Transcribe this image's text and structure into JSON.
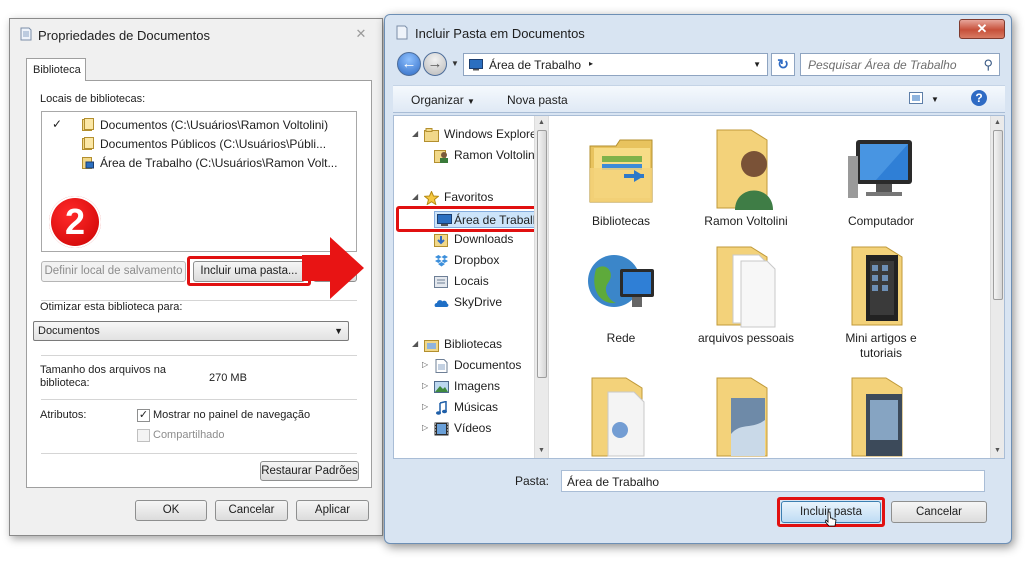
{
  "left_dialog": {
    "title": "Propriedades de Documentos",
    "close_glyph": "✕",
    "tab_label": "Biblioteca",
    "locations_label": "Locais de bibliotecas:",
    "locations": [
      {
        "check": "✓",
        "text": "Documentos (C:\\Usuários\\Ramon Voltolini)",
        "icon": "folder-icon"
      },
      {
        "check": "",
        "text": "Documentos Públicos (C:\\Usuários\\Públi...",
        "icon": "folder-icon"
      },
      {
        "check": "",
        "text": "Área de Trabalho (C:\\Usuários\\Ramon Volt...",
        "icon": "desktop-folder-icon"
      }
    ],
    "step_badge": "2",
    "set_save_label": "Definir local de salvamento",
    "include_folder_label": "Incluir uma pasta...",
    "optimize_label": "Otimizar esta biblioteca para:",
    "optimize_value": "Documentos",
    "size_label": "Tamanho dos arquivos na biblioteca:",
    "size_value": "270 MB",
    "attributes_label": "Atributos:",
    "show_nav_label": "Mostrar no painel de navegação",
    "show_nav_checked": true,
    "shared_label": "Compartilhado",
    "shared_checked": false,
    "restore_label": "Restaurar Padrões",
    "ok_label": "OK",
    "cancel_label": "Cancelar",
    "apply_label": "Aplicar"
  },
  "right_dialog": {
    "title": "Incluir Pasta em Documentos",
    "close_glyph": "✕",
    "address": "Área de Trabalho",
    "address_arrow": "▸",
    "search_placeholder": "Pesquisar Área de Trabalho",
    "toolbar": {
      "organize": "Organizar",
      "new_folder": "Nova pasta"
    },
    "nav": [
      {
        "label": "Windows Explorer",
        "icon": "windows-explorer-icon",
        "level": 0,
        "expander": "◢"
      },
      {
        "label": "Ramon Voltolini",
        "icon": "user-folder-icon",
        "level": 1,
        "expander": ""
      },
      {
        "label": "Favoritos",
        "icon": "star-icon",
        "level": 0,
        "expander": "◢"
      },
      {
        "label": "Área de Trabalho",
        "icon": "desktop-icon",
        "level": 1,
        "expander": "",
        "selected": true
      },
      {
        "label": "Downloads",
        "icon": "downloads-icon",
        "level": 1,
        "expander": ""
      },
      {
        "label": "Dropbox",
        "icon": "dropbox-icon",
        "level": 1,
        "expander": ""
      },
      {
        "label": "Locais",
        "icon": "locais-icon",
        "level": 1,
        "expander": ""
      },
      {
        "label": "SkyDrive",
        "icon": "skydrive-icon",
        "level": 1,
        "expander": ""
      },
      {
        "label": "Bibliotecas",
        "icon": "libraries-icon",
        "level": 0,
        "expander": "◢"
      },
      {
        "label": "Documentos",
        "icon": "documents-icon",
        "level": 1,
        "expander": "▷"
      },
      {
        "label": "Imagens",
        "icon": "pictures-icon",
        "level": 1,
        "expander": "▷"
      },
      {
        "label": "Músicas",
        "icon": "music-icon",
        "level": 1,
        "expander": "▷"
      },
      {
        "label": "Vídeos",
        "icon": "videos-icon",
        "level": 1,
        "expander": "▷"
      }
    ],
    "items": [
      {
        "label": "Bibliotecas",
        "icon": "libraries-folder-icon"
      },
      {
        "label": "Ramon Voltolini",
        "icon": "user-folder-icon"
      },
      {
        "label": "Computador",
        "icon": "computer-icon"
      },
      {
        "label": "Rede",
        "icon": "network-globe-icon"
      },
      {
        "label": "arquivos pessoais",
        "icon": "folder-icon"
      },
      {
        "label": "Mini artigos e tutoriais",
        "icon": "folder-icon"
      },
      {
        "label": "",
        "icon": "folder-icon"
      },
      {
        "label": "",
        "icon": "folder-icon"
      },
      {
        "label": "",
        "icon": "folder-icon"
      }
    ],
    "folder_label": "Pasta:",
    "folder_value": "Área de Trabalho",
    "include_label": "Incluir pasta",
    "cancel_label": "Cancelar"
  },
  "colors": {
    "highlight": "#e11010",
    "accent": "#2f6bc4"
  }
}
